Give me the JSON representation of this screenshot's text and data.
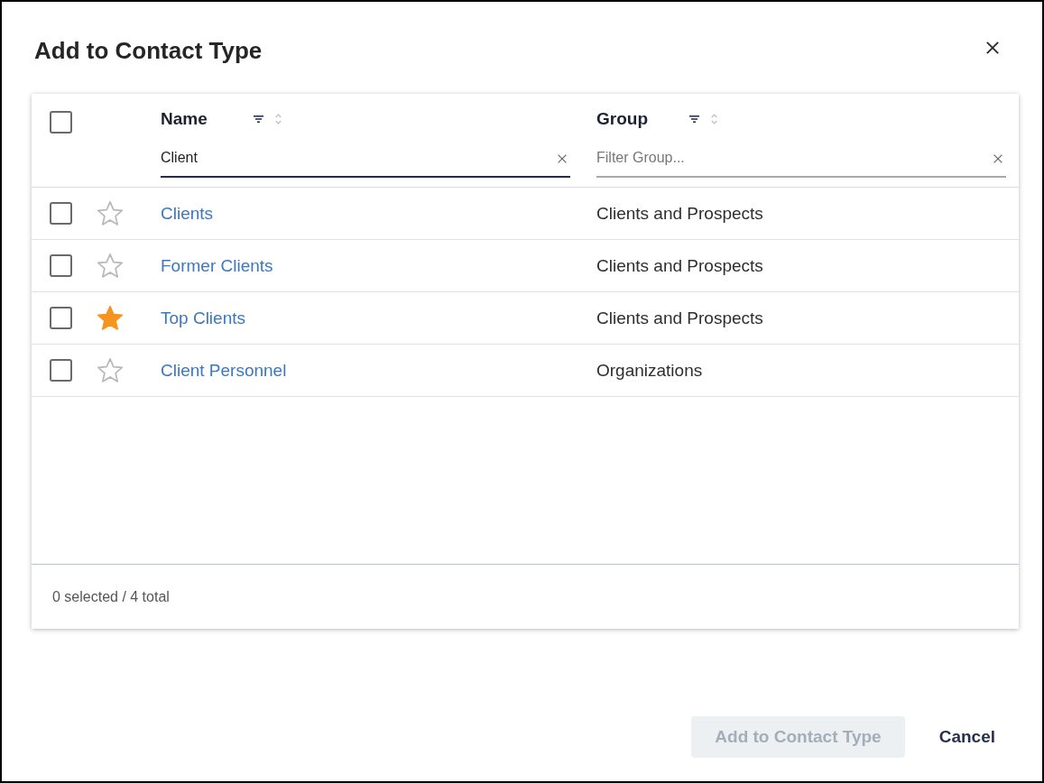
{
  "dialog": {
    "title": "Add to Contact Type"
  },
  "table": {
    "select_all": {
      "checked": false
    },
    "columns": [
      {
        "label": "Name",
        "filter": {
          "value": "Client",
          "focused": true
        }
      },
      {
        "label": "Group",
        "filter": {
          "placeholder": "Filter Group...",
          "focused": false
        }
      }
    ],
    "rows": [
      {
        "checked": false,
        "starred": false,
        "name": "Clients",
        "group": "Clients and Prospects"
      },
      {
        "checked": false,
        "starred": false,
        "name": "Former Clients",
        "group": "Clients and Prospects"
      },
      {
        "checked": false,
        "starred": true,
        "name": "Top Clients",
        "group": "Clients and Prospects"
      },
      {
        "checked": false,
        "starred": false,
        "name": "Client Personnel",
        "group": "Organizations"
      }
    ],
    "footer": "0 selected / 4 total"
  },
  "buttons": [
    {
      "label": "Add to Contact Type",
      "kind": "primary",
      "disabled": true
    },
    {
      "label": "Cancel",
      "kind": "link",
      "disabled": false
    }
  ]
}
